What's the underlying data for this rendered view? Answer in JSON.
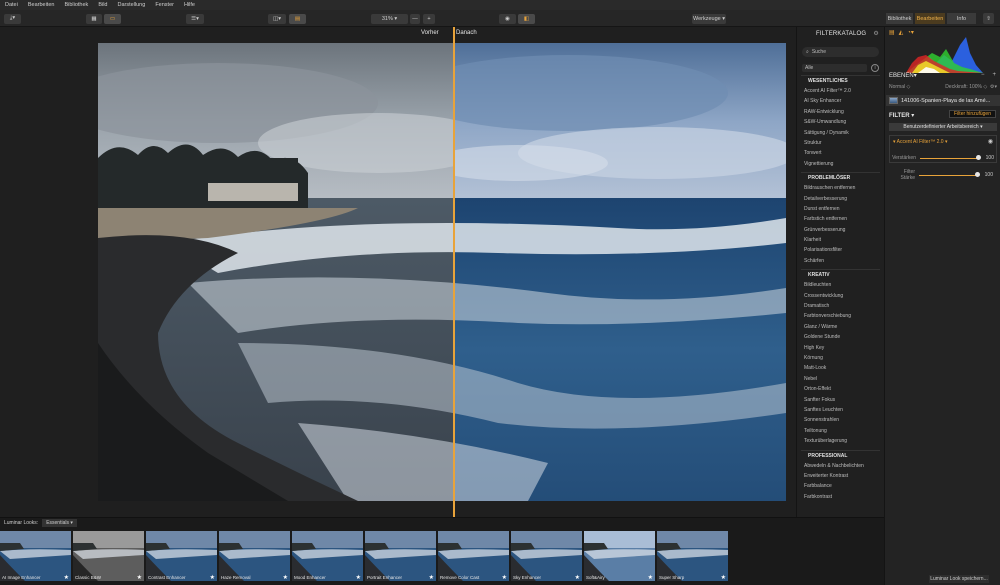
{
  "menu": [
    "Datei",
    "Bearbeiten",
    "Bibliothek",
    "Bild",
    "Darstellung",
    "Fenster",
    "Hilfe"
  ],
  "toolbar": {
    "zoom": "31%",
    "zoom_minus": "—",
    "zoom_plus": "+",
    "tools_label": "Werkzeuge",
    "tabs": [
      "Bibliothek",
      "Bearbeiten",
      "Info"
    ]
  },
  "compare": {
    "before": "Vorher",
    "after": "Danach"
  },
  "catalog": {
    "title": "FILTERKATALOG",
    "search_placeholder": "Suche",
    "filter_select": "Alle",
    "groups": [
      {
        "title": "WESENTLICHES",
        "items": [
          "Accent AI Filter™ 2.0",
          "AI Sky Enhancer",
          "RAW-Entwicklung",
          "S&W-Umwandlung",
          "Sättigung / Dynamik",
          "Struktur",
          "Tonwert",
          "Vignettierung"
        ]
      },
      {
        "title": "PROBLEMLÖSER",
        "items": [
          "Bildrauschen entfernen",
          "Detailverbesserung",
          "Dunst entfernen",
          "Farbstich entfernen",
          "Grünverbesserung",
          "Klarheit",
          "Polarisationsfilter",
          "Schärfen"
        ]
      },
      {
        "title": "KREATIV",
        "items": [
          "Bildleuchten",
          "Crossentwicklung",
          "Dramatisch",
          "Farbtonverschiebung",
          "Glanz / Wärme",
          "Goldene Stunde",
          "High Key",
          "Körnung",
          "Matt-Look",
          "Nebel",
          "Orton-Effekt",
          "Sanfter Fokus",
          "Sanftes Leuchten",
          "Sonnenstrahlen",
          "Teiltonung",
          "Texturüberlagerung"
        ]
      },
      {
        "title": "PROFESSIONAL",
        "items": [
          "Abwedeln & Nachbelichten",
          "Erweiterter Kontrast",
          "Farbbalance",
          "Farbkontrast"
        ]
      }
    ]
  },
  "side": {
    "layers_title": "EBENEN",
    "blend_mode": "Normal",
    "opacity_label": "Deckkraft: 100%",
    "layer_name": "141006-Spanien-Playa de las Amé...",
    "filter_title": "FILTER",
    "filter_add": "Filter hinzufügen",
    "workspace": "Benutzerdefinierter Arbeitsbereich",
    "active_filter": "Accent AI Filter™ 2.0",
    "sliders": [
      {
        "label": "Verstärken",
        "value": "100",
        "fraction": 1.0
      },
      {
        "label": "Filter Stärke",
        "value": "100",
        "fraction": 1.0
      }
    ],
    "save_looks": "Luminar Look speichern..."
  },
  "filmstrip": {
    "label": "Luminar Looks:",
    "tab": "Essentials",
    "looks": [
      {
        "name": "AI Image Enhancer",
        "style": "normal"
      },
      {
        "name": "Classic B&W",
        "style": "bw"
      },
      {
        "name": "Contrast Enhancer",
        "style": "normal"
      },
      {
        "name": "Haze Removal",
        "style": "normal"
      },
      {
        "name": "Mood Enhancer",
        "style": "normal"
      },
      {
        "name": "Portrait Enhancer",
        "style": "normal"
      },
      {
        "name": "Remove Color Cast",
        "style": "normal"
      },
      {
        "name": "Sky Enhancer",
        "style": "normal"
      },
      {
        "name": "Soft&Airy",
        "style": "bright"
      },
      {
        "name": "Super Sharp",
        "style": "normal"
      }
    ]
  },
  "colors": {
    "accent": "#e8a33a"
  }
}
